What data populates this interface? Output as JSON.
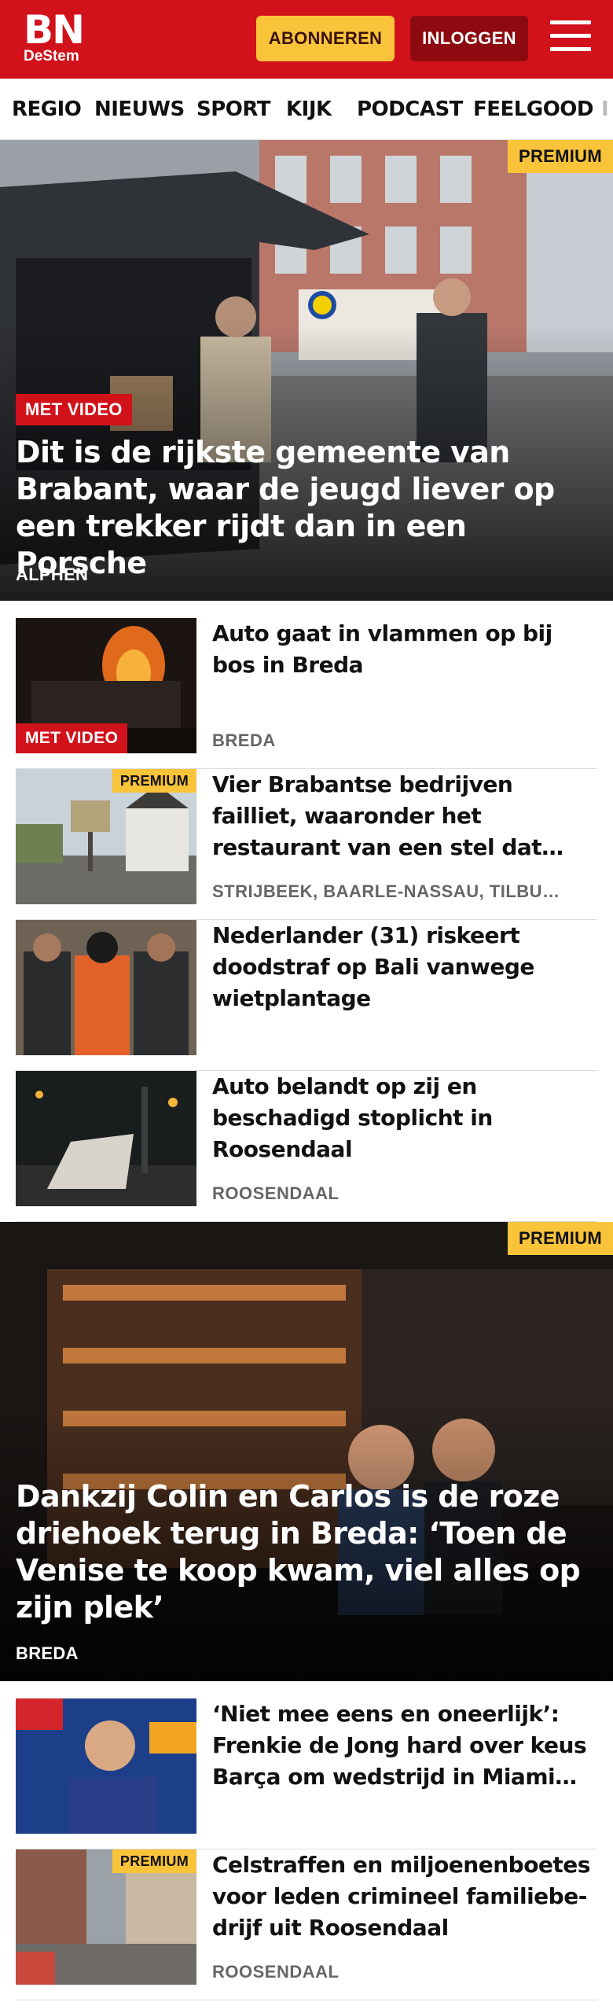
{
  "header": {
    "logo_main": "BN",
    "logo_sub": "DeStem",
    "subscribe_label": "ABONNEREN",
    "login_label": "INLOGGEN",
    "menu_icon": "hamburger-menu-icon"
  },
  "nav": {
    "items": [
      {
        "label": "REGIO"
      },
      {
        "label": "NIEUWS"
      },
      {
        "label": "SPORT"
      },
      {
        "label": "KIJK"
      },
      {
        "label": "PODCAST"
      },
      {
        "label": "FEELGOOD"
      }
    ]
  },
  "hero1": {
    "premium": "PREMIUM",
    "badge": "MET VIDEO",
    "title": "Dit is de rijkste gemeente van Brabant, waar de jeugd liever op een trekker rijdt dan in een Porsche",
    "location": "ALPHEN"
  },
  "list1": [
    {
      "title": "Auto gaat in vlammen op bij bos in Breda",
      "badge": "MET VIDEO",
      "location": "BREDA"
    },
    {
      "title": "Vier Brabantse bedrijven failliet, waaronder het restaurant van een stel dat dacht een succesfo…",
      "premium": "PREMIUM",
      "location": "STRIJBEEK, BAARLE-NASSAU, TILBU…"
    },
    {
      "title": "Nederlander (31) riskeert doodstraf op Bali vanwege wietplantage"
    },
    {
      "title": "Auto belandt op zij en beschadigd stoplicht in Roosendaal",
      "location": "ROOSENDAAL"
    }
  ],
  "hero2": {
    "premium": "PREMIUM",
    "title": "Dankzij Colin en Carlos is de roze driehoek terug in Breda: ‘Toen de Venise te koop kwam, viel alles op zijn plek’",
    "location": "BREDA"
  },
  "list2": [
    {
      "title": "‘Niet mee eens en oneerlijk’: Frenkie de Jong hard over keus Barça om wedstrijd in Miami te…"
    },
    {
      "title": "Celstraffen en miljoenenboetes voor leden crimineel familiebe-drijf uit Roosendaal",
      "premium": "PREMIUM",
      "location": "ROOSENDAAL"
    }
  ],
  "colors": {
    "brand_red": "#d1121b",
    "premium_yellow": "#f9c33a",
    "login_dark_red": "#8c0a10"
  }
}
